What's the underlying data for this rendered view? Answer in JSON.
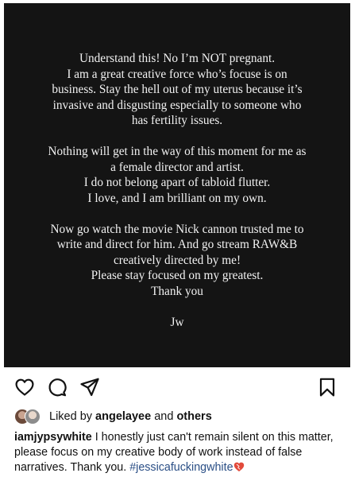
{
  "post": {
    "statement": {
      "paragraphs": [
        [
          "Understand this! No I’m NOT pregnant.",
          "I am a great creative force who’s focuse is on",
          "business. Stay the hell out of my uterus because it’s",
          "invasive and disgusting especially to someone who",
          "has fertility issues."
        ],
        [
          "Nothing will get in the way of this moment for me as",
          "a female director and artist.",
          "I do not belong apart of tabloid flutter.",
          "I love, and I am brilliant on my own."
        ],
        [
          "Now go watch the movie Nick cannon trusted me to",
          "write and direct for him. And go stream RAW&B",
          "creatively directed by me!",
          "Please stay focused on my greatest.",
          "Thank you"
        ]
      ],
      "signature": "Jw"
    }
  },
  "actions": {
    "like_icon": "heart-outline-icon",
    "comment_icon": "comment-bubble-icon",
    "share_icon": "paper-plane-icon",
    "save_icon": "bookmark-icon"
  },
  "likes": {
    "prefix": "Liked by",
    "user": "angelayee",
    "conjunction": "and",
    "others": "others"
  },
  "caption": {
    "username": "iamjypsywhite",
    "text": "I honestly just can't remain silent on this matter, please focus on my creative body of work instead of false narratives. Thank you.",
    "hashtag": "#jessicafuckingwhite",
    "emoji": "heart-emoji"
  },
  "colors": {
    "image_background": "#141414",
    "hashtag": "#2b4f86",
    "emoji_heart": "#e24a3b"
  }
}
